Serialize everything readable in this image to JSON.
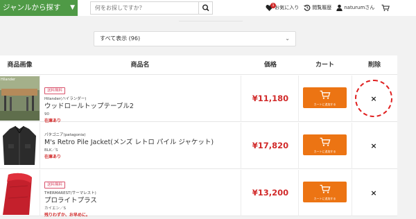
{
  "header": {
    "genre_label": "ジャンルから探す",
    "search_placeholder": "何をお探しですか？",
    "favorites_label": "お気に入り",
    "favorites_count": "1",
    "history_label": "閲覧履歴",
    "user_label": "naturumさん"
  },
  "filter": {
    "selected": "すべて表示 (96)"
  },
  "table": {
    "headers": {
      "image": "商品画像",
      "name": "商品名",
      "price": "価格",
      "cart": "カート",
      "delete": "削除"
    },
    "cart_button_label": "カートに追加する",
    "delete_symbol": "×",
    "rows": [
      {
        "tag": "送料無料",
        "brand": "Hilander(ハイランダー)",
        "name": "ウッドロールトップテーブル2",
        "variant": "90",
        "stock": "在庫あり",
        "price": "¥11,180",
        "thumb_text": "Hilander"
      },
      {
        "tag": "",
        "brand": "パタゴニア(patagonia)",
        "name": "M's Retro Pile Jacket(メンズ レトロ パイル ジャケット)",
        "variant": "BLK／S",
        "stock": "在庫あり",
        "price": "¥17,820"
      },
      {
        "tag": "送料無料",
        "brand": "THERMAREST(サーマレスト)",
        "name": "プロライトプラス",
        "variant": "カイエン／S",
        "stock": "残りわずか、お早めに。",
        "price": "¥13,200"
      }
    ]
  },
  "colors": {
    "genre_green": "#4f9a46",
    "price_red": "#d12a2a",
    "cart_orange": "#ec7413",
    "tag_pink": "#d9506a"
  }
}
